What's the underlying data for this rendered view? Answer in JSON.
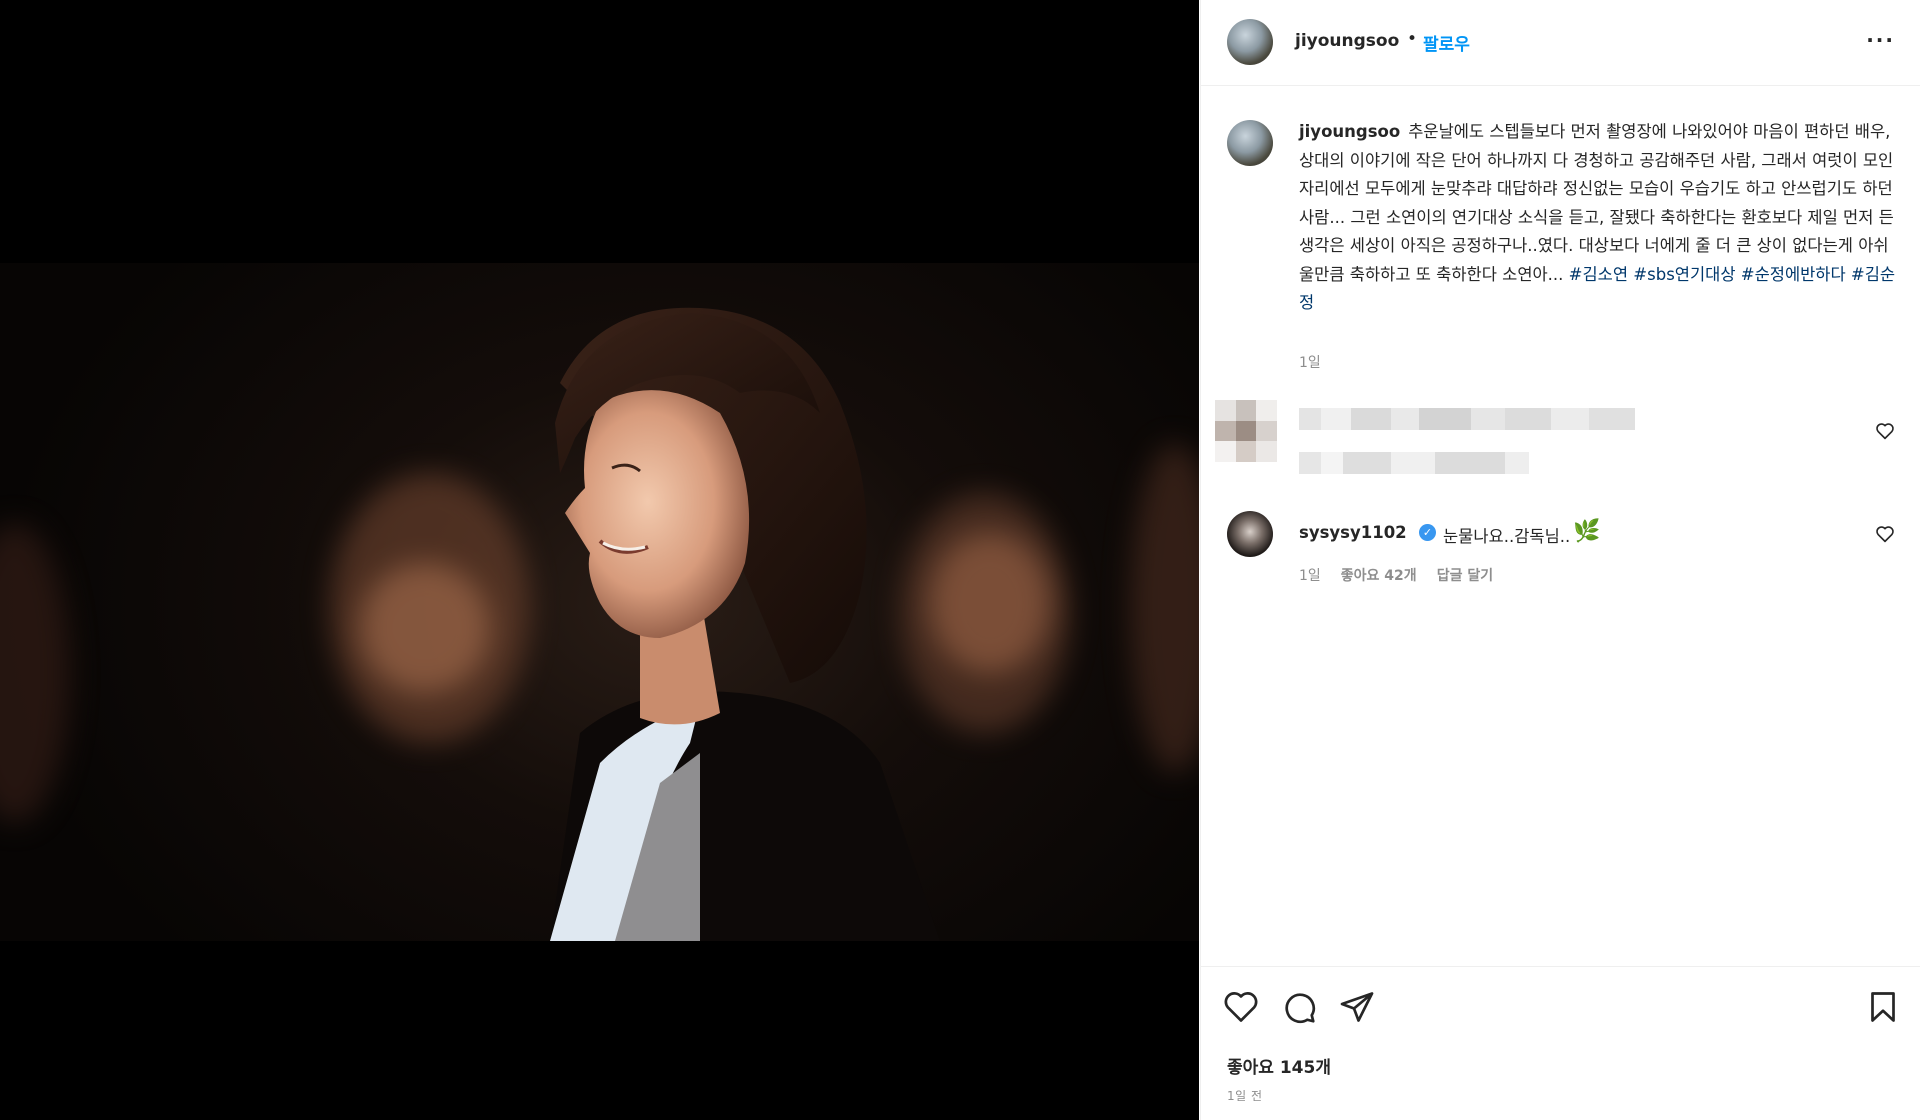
{
  "post": {
    "username": "jiyoungsoo",
    "follow_label": "팔로우",
    "more_label": "···"
  },
  "caption": {
    "username": "jiyoungsoo",
    "text": "추운날에도 스텝들보다 먼저 촬영장에 나와있어야 마음이 편하던 배우, 상대의 이야기에 작은 단어 하나까지 다 경청하고 공감해주던 사람, 그래서 여럿이 모인 자리에선 모두에게 눈맞추랴 대답하랴 정신없는 모습이 우습기도 하고 안쓰럽기도 하던 사람... 그런 소연이의 연기대상 소식을 듣고, 잘됐다 축하한다는 환호보다 제일 먼저 든 생각은 세상이 아직은 공정하구나..였다. 대상보다 너에게 줄 더 큰 상이 없다는게 아쉬울만큼 축하하고 또 축하한다 소연아...",
    "hashtags": [
      "#김소연",
      "#sbs연기대상",
      "#순정에반하다",
      "#김순정"
    ],
    "time": "1일"
  },
  "comments": [
    {
      "username": "sysysy1102",
      "verified": true,
      "text": "눈물나요..감독님..",
      "emoji": "🌿",
      "time": "1일",
      "likes": "좋아요 42개",
      "reply_label": "답글 달기"
    }
  ],
  "footer": {
    "likes": "좋아요 145개",
    "date": "1일 전"
  },
  "icons": {
    "like": "heart-icon",
    "comment": "comment-icon",
    "share": "paper-plane-icon",
    "save": "bookmark-icon",
    "more": "more-icon",
    "verified": "verified-badge-icon"
  },
  "colors": {
    "accent": "#0095f6",
    "hashtag": "#00376b",
    "muted": "#8e8e8e",
    "verified": "#3897f0"
  }
}
